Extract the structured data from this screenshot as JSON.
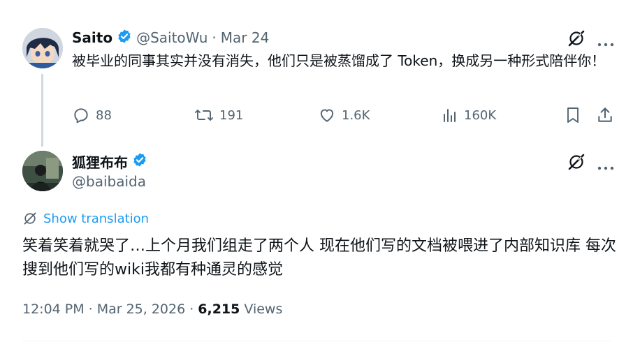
{
  "colors": {
    "accent": "#1d9bf0",
    "muted": "#536471",
    "text": "#0f1419",
    "line": "#cfd9de"
  },
  "quoted": {
    "name": "Saito",
    "handle": "@SaitoWu",
    "separator": "·",
    "date": "Mar 24",
    "text": "被毕业的同事其实并没有消失，他们只是被蒸馏成了 Token，换成另一种形式陪伴你！",
    "actions": {
      "replies": "88",
      "retweets": "191",
      "likes": "1.6K",
      "views": "160K"
    }
  },
  "reply": {
    "name": "狐狸布布",
    "handle": "@baibaida",
    "show_translation": "Show translation",
    "text": "笑着笑着就哭了…上个月我们组走了两个人 现在他们写的文档被喂进了内部知识库 每次搜到他们写的wiki我都有种通灵的感觉",
    "time": "12:04 PM",
    "sep1": "·",
    "date": "Mar 25, 2026",
    "sep2": "·",
    "views_count": "6,215",
    "views_label": "Views"
  }
}
